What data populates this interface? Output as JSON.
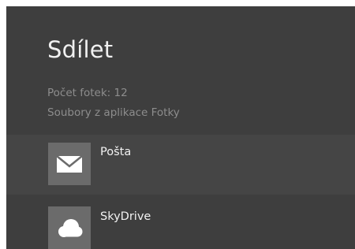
{
  "share": {
    "title": "Sdílet",
    "info": {
      "count": "Počet fotek: 12",
      "source": "Soubory z aplikace Fotky"
    },
    "targets": [
      {
        "label": "Pošta",
        "icon": "mail-icon"
      },
      {
        "label": "SkyDrive",
        "icon": "cloud-icon"
      }
    ]
  },
  "colors": {
    "pane_background": "#3e3e3e",
    "selected_row": "#454545",
    "tile": "#6b6b6b",
    "title_text": "#f0f0f0",
    "secondary_text": "#8d8d8d"
  }
}
